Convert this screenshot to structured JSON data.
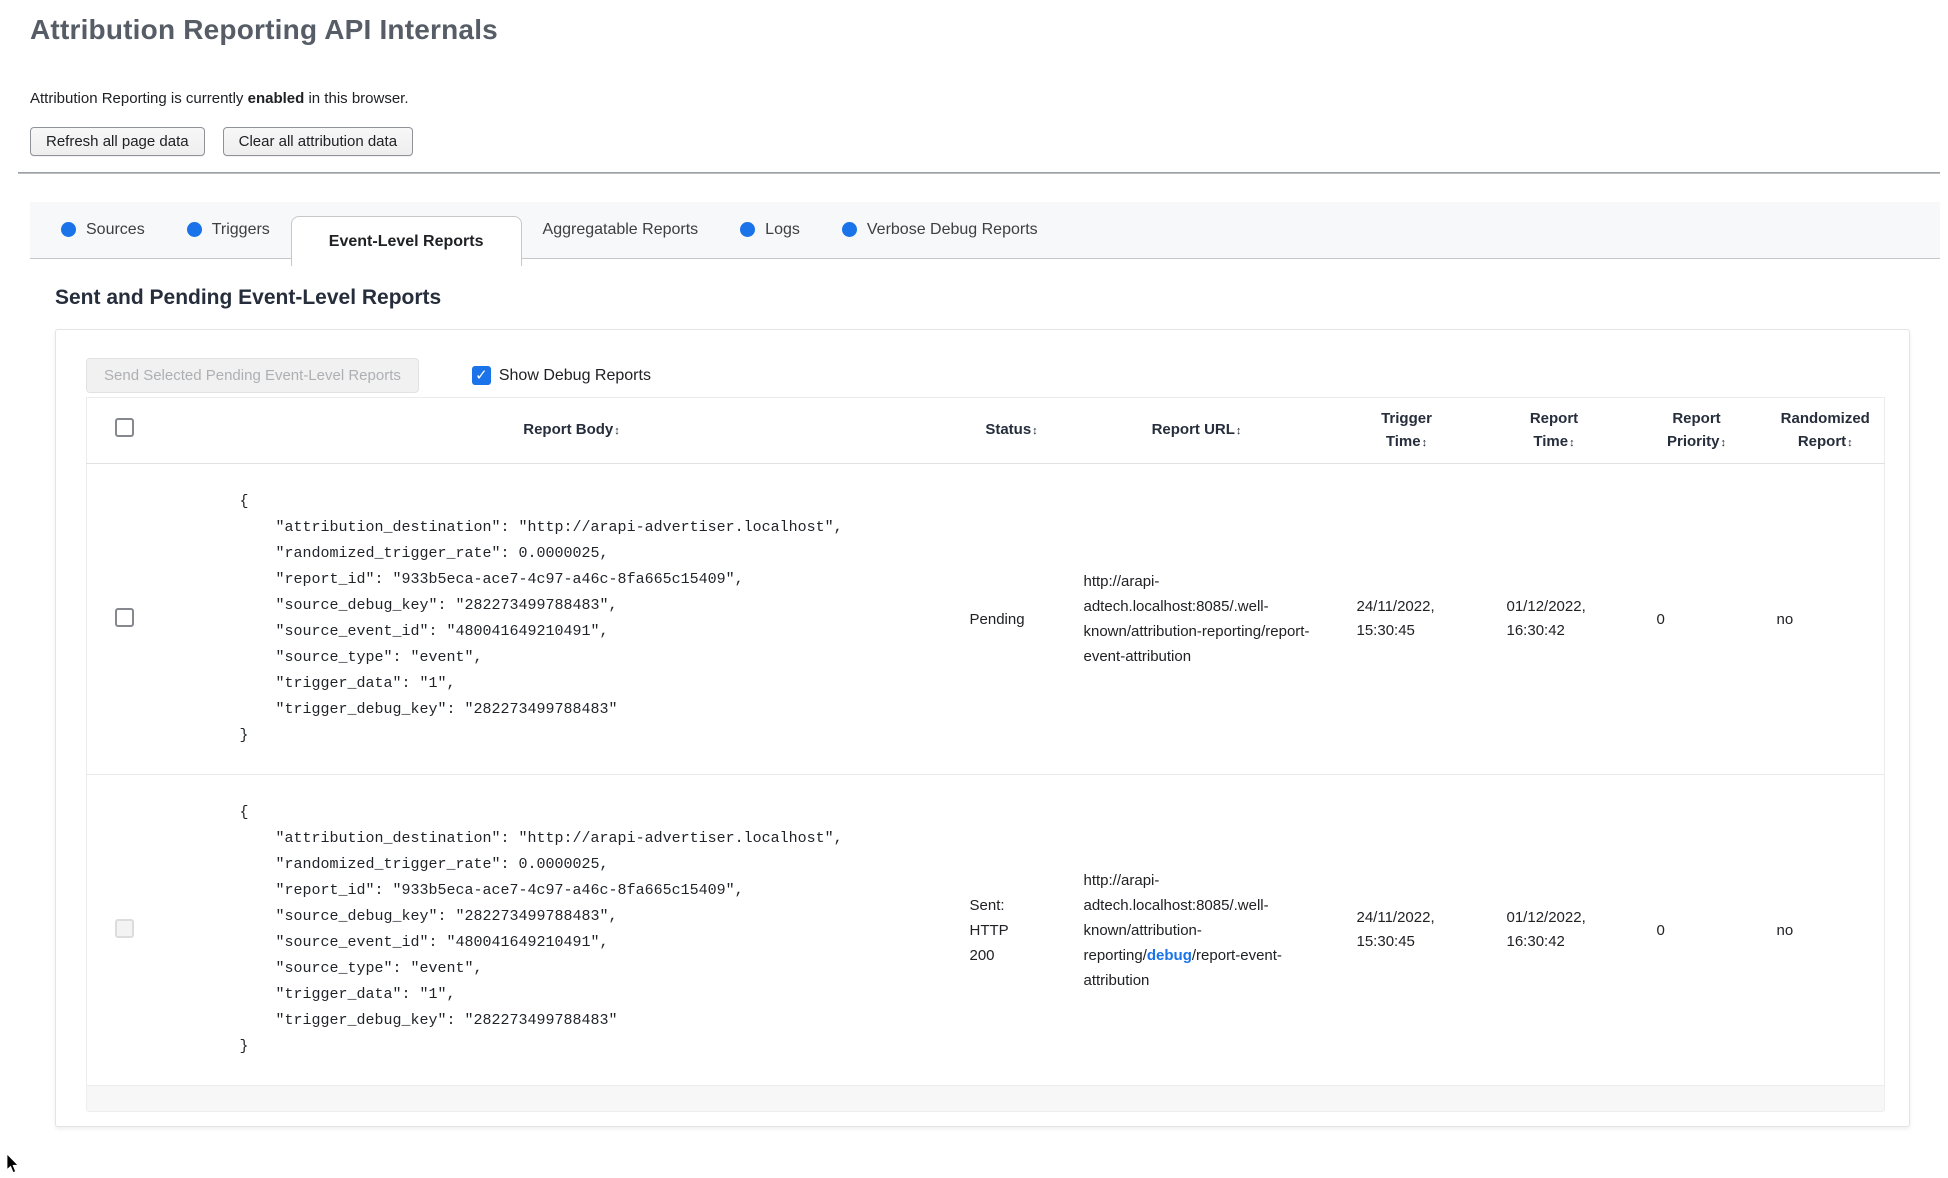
{
  "page": {
    "title": "Attribution Reporting API Internals"
  },
  "status_line": {
    "prefix": "Attribution Reporting is currently ",
    "status": "enabled",
    "suffix": " in this browser."
  },
  "toolbar": {
    "refresh_label": "Refresh all page data",
    "clear_label": "Clear all attribution data"
  },
  "tabs": [
    {
      "label": "Sources",
      "has_dot": true,
      "active": false
    },
    {
      "label": "Triggers",
      "has_dot": true,
      "active": false
    },
    {
      "label": "Event-Level Reports",
      "has_dot": false,
      "active": true
    },
    {
      "label": "Aggregatable Reports",
      "has_dot": false,
      "active": false
    },
    {
      "label": "Logs",
      "has_dot": true,
      "active": false
    },
    {
      "label": "Verbose Debug Reports",
      "has_dot": true,
      "active": false
    }
  ],
  "section": {
    "heading": "Sent and Pending Event-Level Reports",
    "send_button_label": "Send Selected Pending Event-Level Reports",
    "show_debug_label": "Show Debug Reports",
    "show_debug_checked": true
  },
  "table": {
    "columns": [
      {
        "label": "Report Body"
      },
      {
        "label": "Status"
      },
      {
        "label": "Report URL"
      },
      {
        "label": "Trigger Time"
      },
      {
        "label": "Report Time"
      },
      {
        "label": "Report Priority"
      },
      {
        "label": "Randomized Report"
      }
    ],
    "rows": [
      {
        "selected": false,
        "checkbox_enabled": true,
        "body": "{\n    \"attribution_destination\": \"http://arapi-advertiser.localhost\",\n    \"randomized_trigger_rate\": 0.0000025,\n    \"report_id\": \"933b5eca-ace7-4c97-a46c-8fa665c15409\",\n    \"source_debug_key\": \"282273499788483\",\n    \"source_event_id\": \"480041649210491\",\n    \"source_type\": \"event\",\n    \"trigger_data\": \"1\",\n    \"trigger_debug_key\": \"282273499788483\"\n}",
        "status": "Pending",
        "url": "http://arapi-adtech.localhost:8085/.well-known/attribution-reporting/report-event-attribution",
        "trigger_time": "24/11/2022, 15:30:45",
        "report_time": "01/12/2022, 16:30:42",
        "report_priority": "0",
        "randomized_report": "no"
      },
      {
        "selected": false,
        "checkbox_enabled": false,
        "body": "{\n    \"attribution_destination\": \"http://arapi-advertiser.localhost\",\n    \"randomized_trigger_rate\": 0.0000025,\n    \"report_id\": \"933b5eca-ace7-4c97-a46c-8fa665c15409\",\n    \"source_debug_key\": \"282273499788483\",\n    \"source_event_id\": \"480041649210491\",\n    \"source_type\": \"event\",\n    \"trigger_data\": \"1\",\n    \"trigger_debug_key\": \"282273499788483\"\n}",
        "status": "Sent: HTTP 200",
        "url_before": "http://arapi-adtech.localhost:8085/.well-known/attribution-reporting/",
        "url_debug": "debug",
        "url_after": "/report-event-attribution",
        "trigger_time": "24/11/2022, 15:30:45",
        "report_time": "01/12/2022, 16:30:42",
        "report_priority": "0",
        "randomized_report": "no"
      }
    ]
  },
  "icons": {
    "sort": "↕",
    "checkmark": "✓"
  },
  "colors": {
    "accent_blue": "#1a73e8",
    "title_gray": "#565d66",
    "header_navy": "#262e3c"
  }
}
